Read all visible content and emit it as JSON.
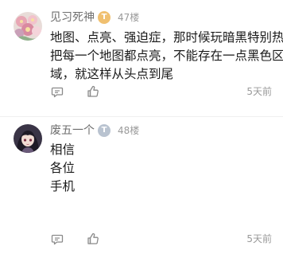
{
  "comments": [
    {
      "username": "见习死神",
      "level_badge": "T",
      "floor": "47楼",
      "content_lines": [
        "地图、点亮、强迫症，那时候玩暗黑特别热衷",
        "把每一个地图都点亮，不能存在一点黑色区",
        "域，就这样从头点到尾"
      ],
      "time": "5天前",
      "reply_icon": "comment-icon",
      "like_icon": "thumbs-up-icon",
      "badge_color": "#f0c070"
    },
    {
      "username": "废五一个",
      "level_badge": "T",
      "floor": "48楼",
      "content_lines": [
        "相信",
        "各位",
        "手机"
      ],
      "time": "5天前",
      "reply_icon": "comment-icon",
      "like_icon": "thumbs-up-icon",
      "badge_color": "#b9c3d0"
    }
  ]
}
